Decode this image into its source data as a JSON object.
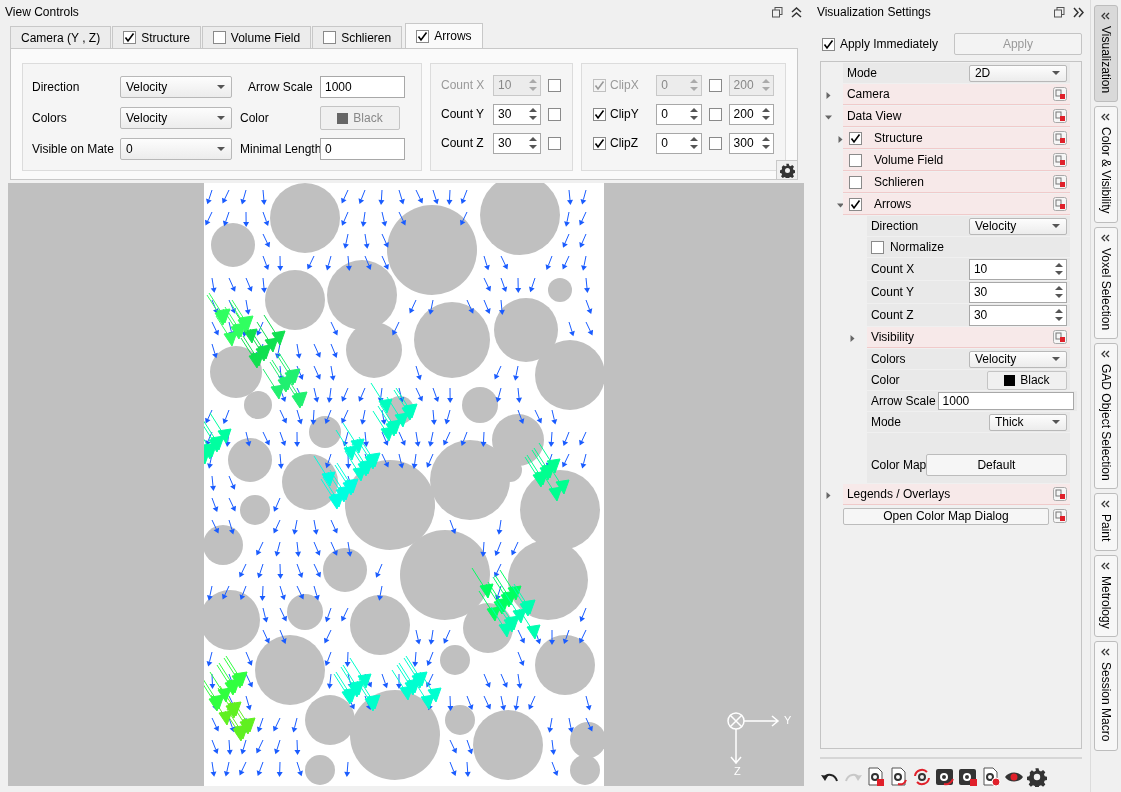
{
  "view_controls": {
    "title": "View Controls",
    "tabs": [
      {
        "kind": "plain",
        "label": "Camera (Y , Z)",
        "selected": false
      },
      {
        "kind": "checkbox",
        "label": "Structure",
        "checked": true,
        "selected": false
      },
      {
        "kind": "checkbox",
        "label": "Volume Field",
        "checked": false,
        "selected": false
      },
      {
        "kind": "checkbox",
        "label": "Schlieren",
        "checked": false,
        "selected": false
      },
      {
        "kind": "checkbox",
        "label": "Arrows",
        "checked": true,
        "selected": true
      }
    ],
    "fields": [
      {
        "kind": "dropdown",
        "label": "Direction",
        "value": "Velocity"
      },
      {
        "kind": "input",
        "label": "Arrow Scale",
        "value": "1000"
      },
      {
        "kind": "dropdown",
        "label": "Colors",
        "value": "Velocity"
      },
      {
        "kind": "color_button",
        "label": "Color",
        "value": "Black",
        "disabled": true
      },
      {
        "kind": "dropdown",
        "label": "Visible on Mate",
        "value": "0"
      },
      {
        "kind": "input",
        "label": "Minimal Length",
        "value": "0"
      }
    ],
    "counts": [
      {
        "label": "Count X",
        "value": "10",
        "disabled": true,
        "checked": false
      },
      {
        "label": "Count Y",
        "value": "30",
        "disabled": false,
        "checked": false
      },
      {
        "label": "Count Z",
        "value": "30",
        "disabled": false,
        "checked": false
      }
    ],
    "clips": [
      {
        "label": "ClipX",
        "checked": true,
        "disabled": true,
        "min": "0",
        "lock_checked": false,
        "max": "200"
      },
      {
        "label": "ClipY",
        "checked": true,
        "disabled": false,
        "min": "0",
        "lock_checked": false,
        "max": "200"
      },
      {
        "label": "ClipZ",
        "checked": true,
        "disabled": false,
        "min": "0",
        "lock_checked": false,
        "max": "300"
      }
    ]
  },
  "viewport": {
    "axis_horizontal": "Y",
    "axis_vertical": "Z"
  },
  "settings": {
    "title": "Visualization Settings",
    "apply_immediately": {
      "label": "Apply Immediately",
      "checked": true
    },
    "apply_button": {
      "label": "Apply",
      "disabled": true
    },
    "tree": [
      {
        "kind": "dropdown",
        "label": "Mode",
        "value": "2D"
      },
      {
        "kind": "group",
        "label": "Camera",
        "expanded": false
      },
      {
        "kind": "group",
        "label": "Data View",
        "expanded": true,
        "children": [
          {
            "kind": "check_group",
            "label": "Structure",
            "checked": true,
            "expanded": false
          },
          {
            "kind": "check_group",
            "label": "Volume Field",
            "checked": false
          },
          {
            "kind": "check_group",
            "label": "Schlieren",
            "checked": false
          },
          {
            "kind": "check_group",
            "label": "Arrows",
            "checked": true,
            "expanded": true,
            "children": [
              {
                "kind": "dropdown",
                "label": "Direction",
                "value": "Velocity"
              },
              {
                "kind": "checkbox",
                "label": "Normalize",
                "checked": false
              },
              {
                "kind": "spin",
                "label": "Count X",
                "value": "10"
              },
              {
                "kind": "spin",
                "label": "Count Y",
                "value": "30"
              },
              {
                "kind": "spin",
                "label": "Count Z",
                "value": "30"
              },
              {
                "kind": "group",
                "label": "Visibility",
                "expanded": false
              },
              {
                "kind": "dropdown",
                "label": "Colors",
                "value": "Velocity"
              },
              {
                "kind": "color_button",
                "label": "Color",
                "value": "Black"
              },
              {
                "kind": "input",
                "label": "Arrow Scale",
                "value": "1000"
              },
              {
                "kind": "dropdown",
                "label": "Mode",
                "value": "Thick"
              },
              {
                "kind": "button",
                "label": "Color Map",
                "value": "Default"
              }
            ]
          }
        ]
      },
      {
        "kind": "group",
        "label": "Legends / Overlays",
        "expanded": false
      },
      {
        "kind": "action",
        "label": "Open Color Map Dialog"
      }
    ],
    "toolbar": [
      {
        "kind": "undo",
        "disabled": false
      },
      {
        "kind": "redo",
        "disabled": true
      },
      {
        "kind": "doc_delete",
        "disabled": false
      },
      {
        "kind": "doc_reload",
        "disabled": false
      },
      {
        "kind": "refresh",
        "disabled": false
      },
      {
        "kind": "dark_reload",
        "disabled": false
      },
      {
        "kind": "dark_delete",
        "disabled": false
      },
      {
        "kind": "record",
        "disabled": false
      },
      {
        "kind": "eye",
        "disabled": false
      },
      {
        "kind": "gear",
        "disabled": false
      }
    ]
  },
  "side_tabs": [
    {
      "label": "Visualization",
      "selected": true
    },
    {
      "label": "Color & Visibility",
      "selected": false
    },
    {
      "label": "Voxel Selection",
      "selected": false
    },
    {
      "label": "GAD Object Selection",
      "selected": false
    },
    {
      "label": "Paint",
      "selected": false
    },
    {
      "label": "Metrology",
      "selected": false
    },
    {
      "label": "Session Macro",
      "selected": false
    }
  ]
}
